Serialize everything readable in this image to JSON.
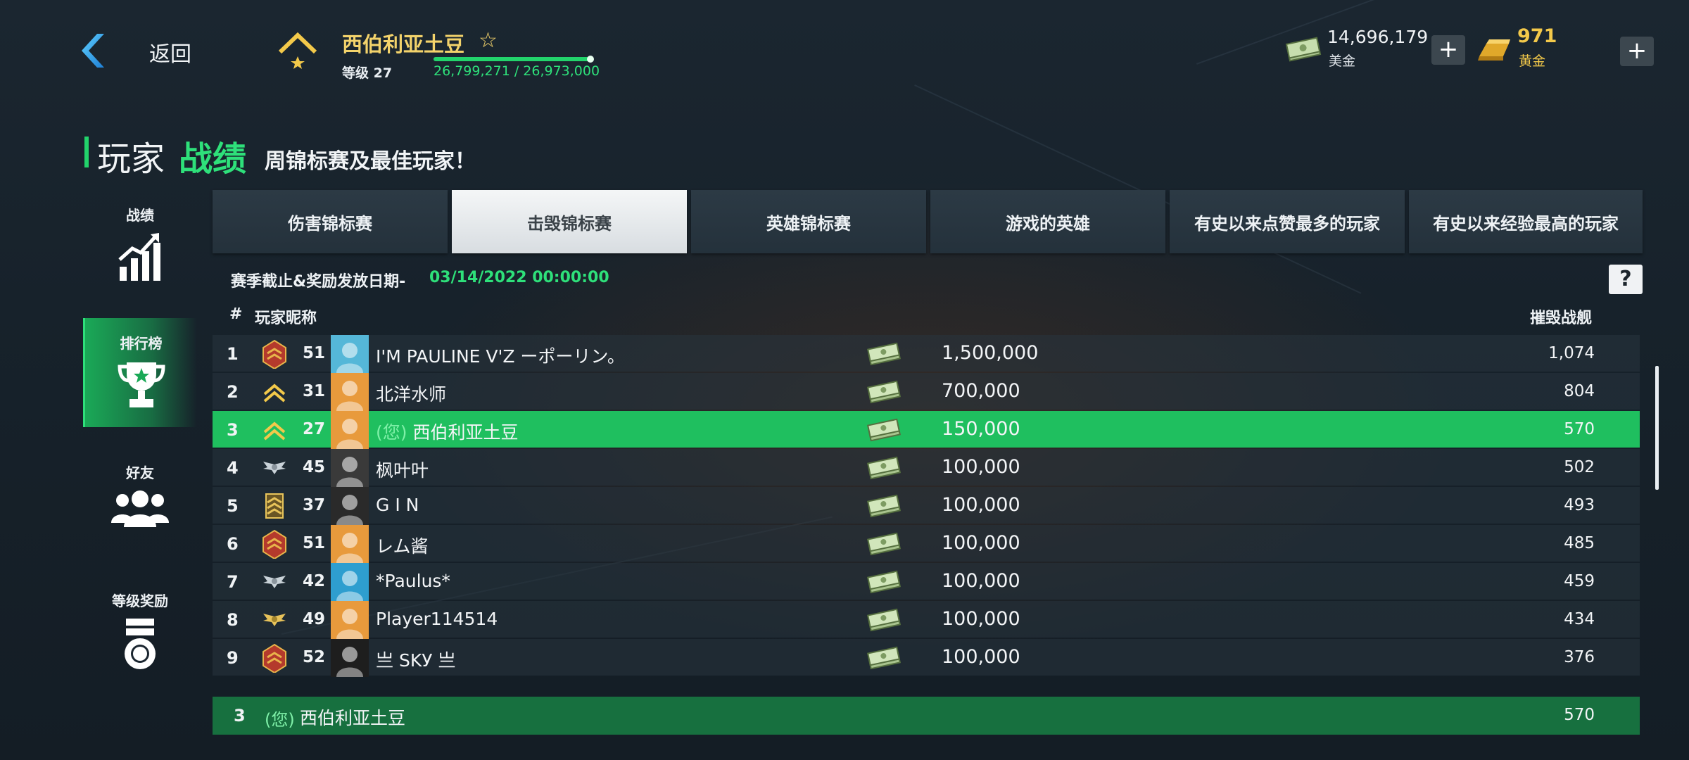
{
  "header": {
    "back_label": "返回",
    "player_name": "西伯利亚土豆",
    "level_label": "等级 27",
    "xp_text": "26,799,271 / 26,973,000",
    "xp_progress": 0.9936,
    "currency": {
      "cash_value": "14,696,179",
      "cash_label": "美金",
      "gold_value": "971",
      "gold_label": "黄金",
      "plus_label": "+"
    }
  },
  "title": {
    "part1": "玩家",
    "part2": "战绩",
    "subtitle": "周锦标赛及最佳玩家！"
  },
  "sidebar": {
    "items": [
      {
        "label": "战绩",
        "icon": "stats-chart-icon",
        "active": false
      },
      {
        "label": "排行榜",
        "icon": "trophy-icon",
        "active": true
      },
      {
        "label": "好友",
        "icon": "friends-icon",
        "active": false
      },
      {
        "label": "等级奖励",
        "icon": "medal-icon",
        "active": false
      }
    ]
  },
  "tabs": [
    {
      "label": "伤害锦标赛",
      "active": false
    },
    {
      "label": "击毁锦标赛",
      "active": true
    },
    {
      "label": "英雄锦标赛",
      "active": false
    },
    {
      "label": "游戏的英雄",
      "active": false
    },
    {
      "label": "有史以来点赞最多的玩家",
      "active": false
    },
    {
      "label": "有史以来经验最高的玩家",
      "active": false
    }
  ],
  "season": {
    "label": "赛季截止&奖励发放日期-",
    "date": "03/14/2022 00:00:00",
    "help_label": "?"
  },
  "columns": {
    "rank": "#",
    "nickname": "玩家昵称",
    "destroyed": "摧毁战舰"
  },
  "rows": [
    {
      "rank": "1",
      "level": "51",
      "name": "I'M PAULINE  V'Z  ーポーリン。",
      "reward": "1,500,000",
      "destroyed": "1,074",
      "emblem": "red-rank-emblem",
      "you": false
    },
    {
      "rank": "2",
      "level": "31",
      "name": "北洋水师",
      "reward": "700,000",
      "destroyed": "804",
      "emblem": "gold-chevron-emblem",
      "you": false
    },
    {
      "rank": "3",
      "level": "27",
      "name": "西伯利亚土豆",
      "you_label": "(您)",
      "reward": "150,000",
      "destroyed": "570",
      "emblem": "gold-chevron-emblem",
      "you": true
    },
    {
      "rank": "4",
      "level": "45",
      "name": "枫叶叶",
      "reward": "100,000",
      "destroyed": "502",
      "emblem": "silver-wings-emblem",
      "you": false
    },
    {
      "rank": "5",
      "level": "37",
      "name": "G I N",
      "reward": "100,000",
      "destroyed": "493",
      "emblem": "gold-stripes-emblem",
      "you": false
    },
    {
      "rank": "6",
      "level": "51",
      "name": "レム酱",
      "reward": "100,000",
      "destroyed": "485",
      "emblem": "red-rank-emblem",
      "you": false
    },
    {
      "rank": "7",
      "level": "42",
      "name": "*Paulus*",
      "reward": "100,000",
      "destroyed": "459",
      "emblem": "silver-wings-emblem",
      "you": false
    },
    {
      "rank": "8",
      "level": "49",
      "name": "Player114514",
      "reward": "100,000",
      "destroyed": "434",
      "emblem": "gold-wings-emblem",
      "you": false
    },
    {
      "rank": "9",
      "level": "52",
      "name": "亗 SKУ 亗",
      "reward": "100,000",
      "destroyed": "376",
      "emblem": "red-rank-emblem",
      "you": false
    }
  ],
  "self_row": {
    "rank": "3",
    "you_label": "(您)",
    "name": "西伯利亚土豆",
    "destroyed": "570"
  },
  "colors": {
    "accent_green": "#22d36b",
    "highlight_row": "#1fbf5f",
    "gold": "#f3c94a"
  }
}
